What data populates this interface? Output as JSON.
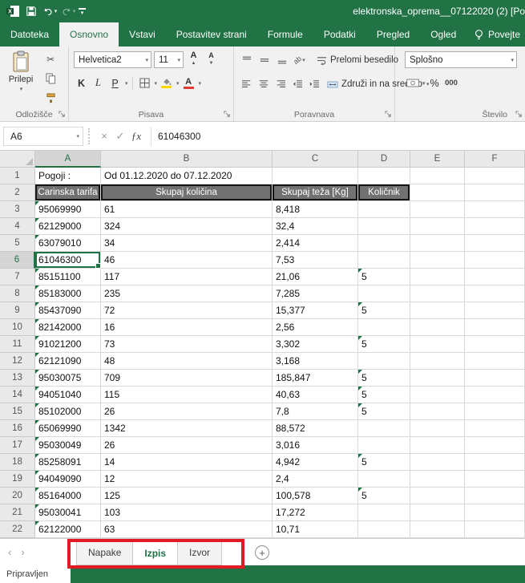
{
  "title_bar": {
    "title": "elektronska_oprema__07122020 (2) [Po"
  },
  "ribbon": {
    "tabs": [
      {
        "label": "Datoteka"
      },
      {
        "label": "Osnovno"
      },
      {
        "label": "Vstavi"
      },
      {
        "label": "Postavitev strani"
      },
      {
        "label": "Formule"
      },
      {
        "label": "Podatki"
      },
      {
        "label": "Pregled"
      },
      {
        "label": "Ogled"
      }
    ],
    "selected_tab": "Osnovno",
    "tell_me_label": "Povejte",
    "groups": {
      "clipboard": {
        "label": "Odložišče",
        "paste_label": "Prilepi"
      },
      "font": {
        "label": "Pisava",
        "font_name": "Helvetica2",
        "font_size": "11",
        "bold_label": "K",
        "italic_label": "L",
        "underline_label": "P"
      },
      "alignment": {
        "label": "Poravnava",
        "wrap_text_label": "Prelomi besedilo",
        "merge_center_label": "Združi in na sredino"
      },
      "number": {
        "label": "Število",
        "format_value": "Splošno",
        "percent_label": "%",
        "thousands_label": "000"
      }
    }
  },
  "formula_bar": {
    "name_box": "A6",
    "fx_label": "ƒx",
    "value": "61046300"
  },
  "grid": {
    "column_headers": [
      "A",
      "B",
      "C",
      "D",
      "E",
      "F"
    ],
    "selected_cell": "A6",
    "selected_column": "A",
    "selected_row": 6,
    "row1": {
      "label": "Pogoji :",
      "value": "Od 01.12.2020 do 07.12.2020"
    },
    "table_headers": [
      "Carinska tarifa",
      "Skupaj količina",
      "Skupaj teža [Kg]",
      "Količnik"
    ],
    "data_rows": [
      {
        "r": 3,
        "a": "95069990",
        "b": "61",
        "c": "8,418",
        "d": ""
      },
      {
        "r": 4,
        "a": "62129000",
        "b": "324",
        "c": "32,4",
        "d": ""
      },
      {
        "r": 5,
        "a": "63079010",
        "b": "34",
        "c": "2,414",
        "d": ""
      },
      {
        "r": 6,
        "a": "61046300",
        "b": "46",
        "c": "7,53",
        "d": ""
      },
      {
        "r": 7,
        "a": "85151100",
        "b": "117",
        "c": "21,06",
        "d": "5"
      },
      {
        "r": 8,
        "a": "85183000",
        "b": "235",
        "c": "7,285",
        "d": ""
      },
      {
        "r": 9,
        "a": "85437090",
        "b": "72",
        "c": "15,377",
        "d": "5"
      },
      {
        "r": 10,
        "a": "82142000",
        "b": "16",
        "c": "2,56",
        "d": ""
      },
      {
        "r": 11,
        "a": "91021200",
        "b": "73",
        "c": "3,302",
        "d": "5"
      },
      {
        "r": 12,
        "a": "62121090",
        "b": "48",
        "c": "3,168",
        "d": ""
      },
      {
        "r": 13,
        "a": "95030075",
        "b": "709",
        "c": "185,847",
        "d": "5"
      },
      {
        "r": 14,
        "a": "94051040",
        "b": "115",
        "c": "40,63",
        "d": "5"
      },
      {
        "r": 15,
        "a": "85102000",
        "b": "26",
        "c": "7,8",
        "d": "5"
      },
      {
        "r": 16,
        "a": "65069990",
        "b": "1342",
        "c": "88,572",
        "d": ""
      },
      {
        "r": 17,
        "a": "95030049",
        "b": "26",
        "c": "3,016",
        "d": ""
      },
      {
        "r": 18,
        "a": "85258091",
        "b": "14",
        "c": "4,942",
        "d": "5"
      },
      {
        "r": 19,
        "a": "94049090",
        "b": "12",
        "c": "2,4",
        "d": ""
      },
      {
        "r": 20,
        "a": "85164000",
        "b": "125",
        "c": "100,578",
        "d": "5"
      },
      {
        "r": 21,
        "a": "95030041",
        "b": "103",
        "c": "17,272",
        "d": ""
      },
      {
        "r": 22,
        "a": "62122000",
        "b": "63",
        "c": "10,71",
        "d": ""
      }
    ]
  },
  "sheet_tabs": {
    "tabs": [
      {
        "label": "Napake",
        "selected": false
      },
      {
        "label": "Izpis",
        "selected": true
      },
      {
        "label": "Izvor",
        "selected": false
      }
    ],
    "add_label": "+"
  },
  "status_bar": {
    "status": "Pripravljen"
  },
  "colors": {
    "accent_green": "#217346",
    "annotation_red": "#e01b24",
    "table_header_fill": "#717171",
    "error_indicator_green": "#1e7145"
  }
}
